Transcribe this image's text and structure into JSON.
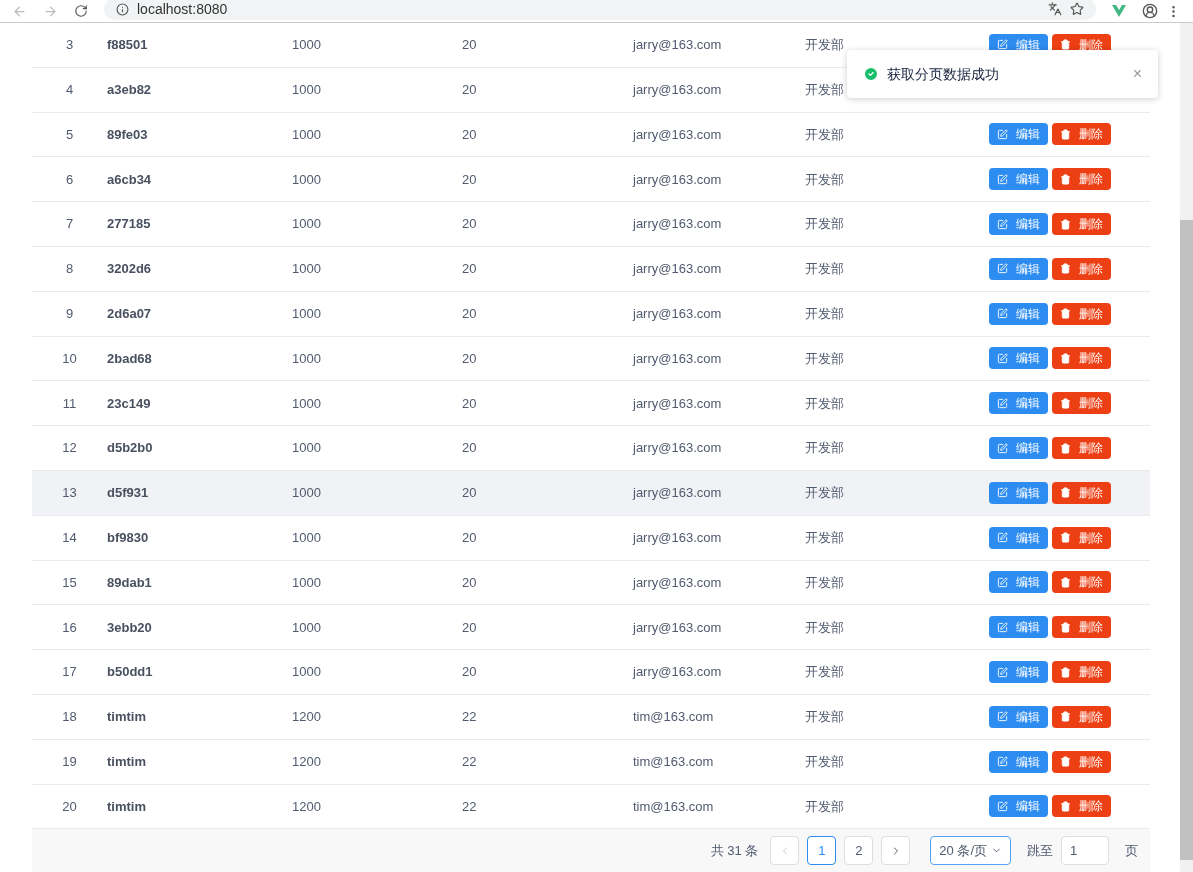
{
  "browser": {
    "url": "localhost:8080"
  },
  "table": {
    "rows": [
      {
        "index": "3",
        "name": "f88501",
        "salary": "1000",
        "age": "20",
        "email": "jarry@163.com",
        "dept": "开发部",
        "highlighted": false,
        "actions": [
          {
            "kind": "edit",
            "label": "编辑"
          },
          {
            "kind": "delete",
            "label": "删除"
          }
        ]
      },
      {
        "index": "4",
        "name": "a3eb82",
        "salary": "1000",
        "age": "20",
        "email": "jarry@163.com",
        "dept": "开发部",
        "highlighted": false
      },
      {
        "index": "5",
        "name": "89fe03",
        "salary": "1000",
        "age": "20",
        "email": "jarry@163.com",
        "dept": "开发部",
        "highlighted": false,
        "actions": [
          {
            "kind": "edit",
            "label": "编辑"
          },
          {
            "kind": "delete",
            "label": "删除"
          }
        ]
      },
      {
        "index": "6",
        "name": "a6cb34",
        "salary": "1000",
        "age": "20",
        "email": "jarry@163.com",
        "dept": "开发部",
        "highlighted": false,
        "actions": [
          {
            "kind": "edit",
            "label": "编辑"
          },
          {
            "kind": "delete",
            "label": "删除"
          }
        ]
      },
      {
        "index": "7",
        "name": "277185",
        "salary": "1000",
        "age": "20",
        "email": "jarry@163.com",
        "dept": "开发部",
        "highlighted": false,
        "actions": [
          {
            "kind": "edit",
            "label": "编辑"
          },
          {
            "kind": "delete",
            "label": "删除"
          }
        ]
      },
      {
        "index": "8",
        "name": "3202d6",
        "salary": "1000",
        "age": "20",
        "email": "jarry@163.com",
        "dept": "开发部",
        "highlighted": false,
        "actions": [
          {
            "kind": "edit",
            "label": "编辑"
          },
          {
            "kind": "delete",
            "label": "删除"
          }
        ]
      },
      {
        "index": "9",
        "name": "2d6a07",
        "salary": "1000",
        "age": "20",
        "email": "jarry@163.com",
        "dept": "开发部",
        "highlighted": false,
        "actions": [
          {
            "kind": "edit",
            "label": "编辑"
          },
          {
            "kind": "delete",
            "label": "删除"
          }
        ]
      },
      {
        "index": "10",
        "name": "2bad68",
        "salary": "1000",
        "age": "20",
        "email": "jarry@163.com",
        "dept": "开发部",
        "highlighted": false,
        "actions": [
          {
            "kind": "edit",
            "label": "编辑"
          },
          {
            "kind": "delete",
            "label": "删除"
          }
        ]
      },
      {
        "index": "11",
        "name": "23c149",
        "salary": "1000",
        "age": "20",
        "email": "jarry@163.com",
        "dept": "开发部",
        "highlighted": false,
        "actions": [
          {
            "kind": "edit",
            "label": "编辑"
          },
          {
            "kind": "delete",
            "label": "删除"
          }
        ]
      },
      {
        "index": "12",
        "name": "d5b2b0",
        "salary": "1000",
        "age": "20",
        "email": "jarry@163.com",
        "dept": "开发部",
        "highlighted": false,
        "actions": [
          {
            "kind": "edit",
            "label": "编辑"
          },
          {
            "kind": "delete",
            "label": "删除"
          }
        ]
      },
      {
        "index": "13",
        "name": "d5f931",
        "salary": "1000",
        "age": "20",
        "email": "jarry@163.com",
        "dept": "开发部",
        "highlighted": true,
        "actions": [
          {
            "kind": "edit",
            "label": "编辑"
          },
          {
            "kind": "delete",
            "label": "删除"
          }
        ]
      },
      {
        "index": "14",
        "name": "bf9830",
        "salary": "1000",
        "age": "20",
        "email": "jarry@163.com",
        "dept": "开发部",
        "highlighted": false,
        "actions": [
          {
            "kind": "edit",
            "label": "编辑"
          },
          {
            "kind": "delete",
            "label": "删除"
          }
        ]
      },
      {
        "index": "15",
        "name": "89dab1",
        "salary": "1000",
        "age": "20",
        "email": "jarry@163.com",
        "dept": "开发部",
        "highlighted": false,
        "actions": [
          {
            "kind": "edit",
            "label": "编辑"
          },
          {
            "kind": "delete",
            "label": "删除"
          }
        ]
      },
      {
        "index": "16",
        "name": "3ebb20",
        "salary": "1000",
        "age": "20",
        "email": "jarry@163.com",
        "dept": "开发部",
        "highlighted": false,
        "actions": [
          {
            "kind": "edit",
            "label": "编辑"
          },
          {
            "kind": "delete",
            "label": "删除"
          }
        ]
      },
      {
        "index": "17",
        "name": "b50dd1",
        "salary": "1000",
        "age": "20",
        "email": "jarry@163.com",
        "dept": "开发部",
        "highlighted": false,
        "actions": [
          {
            "kind": "edit",
            "label": "编辑"
          },
          {
            "kind": "delete",
            "label": "删除"
          }
        ]
      },
      {
        "index": "18",
        "name": "timtim",
        "salary": "1200",
        "age": "22",
        "email": "tim@163.com",
        "dept": "开发部",
        "highlighted": false,
        "actions": [
          {
            "kind": "edit",
            "label": "编辑"
          },
          {
            "kind": "delete",
            "label": "删除"
          }
        ]
      },
      {
        "index": "19",
        "name": "timtim",
        "salary": "1200",
        "age": "22",
        "email": "tim@163.com",
        "dept": "开发部",
        "highlighted": false,
        "actions": [
          {
            "kind": "edit",
            "label": "编辑"
          },
          {
            "kind": "delete",
            "label": "删除"
          }
        ]
      },
      {
        "index": "20",
        "name": "timtim",
        "salary": "1200",
        "age": "22",
        "email": "tim@163.com",
        "dept": "开发部",
        "highlighted": false,
        "actions": [
          {
            "kind": "edit",
            "label": "编辑"
          },
          {
            "kind": "delete",
            "label": "删除"
          }
        ]
      }
    ]
  },
  "pagination": {
    "total": "共 31 条",
    "pages": [
      {
        "label": "1",
        "selected": true
      },
      {
        "label": "2",
        "selected": false
      }
    ],
    "page_size": "20 条/页",
    "jump_label": "跳至",
    "jump_value": "1",
    "page_suffix": "页"
  },
  "toast": {
    "message": "获取分页数据成功",
    "close": "×"
  }
}
